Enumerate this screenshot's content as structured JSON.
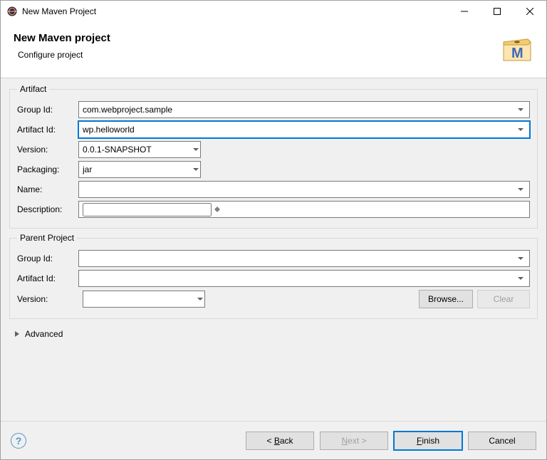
{
  "titlebar": {
    "title": "New Maven Project"
  },
  "header": {
    "title": "New Maven project",
    "subtitle": "Configure project"
  },
  "artifact": {
    "legend": "Artifact",
    "labels": {
      "groupId": "Group Id:",
      "artifactId": "Artifact Id:",
      "version": "Version:",
      "packaging": "Packaging:",
      "name": "Name:",
      "description": "Description:"
    },
    "groupId": "com.webproject.sample",
    "artifactId": "wp.helloworld",
    "version": "0.0.1-SNAPSHOT",
    "packaging": "jar",
    "name": "",
    "description": ""
  },
  "parent": {
    "legend": "Parent Project",
    "labels": {
      "groupId": "Group Id:",
      "artifactId": "Artifact Id:",
      "version": "Version:"
    },
    "groupId": "",
    "artifactId": "",
    "version": "",
    "browse": "Browse...",
    "clear": "Clear"
  },
  "advanced": {
    "label": "Advanced"
  },
  "buttons": {
    "back": "< Back",
    "next": "Next >",
    "finish": "Finish",
    "cancel": "Cancel"
  }
}
